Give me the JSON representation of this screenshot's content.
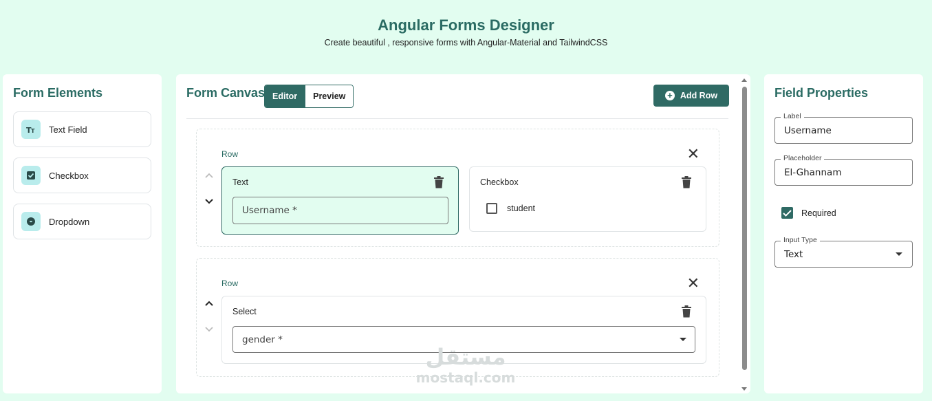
{
  "header": {
    "title": "Angular Forms Designer",
    "subtitle": "Create beautiful , responsive forms with Angular-Material and TailwindCSS"
  },
  "elements_panel": {
    "title": "Form Elements",
    "items": [
      {
        "label": "Text Field",
        "icon": "text-format-icon"
      },
      {
        "label": "Checkbox",
        "icon": "checkbox-icon"
      },
      {
        "label": "Dropdown",
        "icon": "dropdown-icon"
      }
    ]
  },
  "canvas": {
    "title": "Form Canvas",
    "tabs": [
      {
        "label": "Editor",
        "active": true
      },
      {
        "label": "Preview",
        "active": false
      }
    ],
    "add_row_label": "Add Row",
    "rows": [
      {
        "label": "Row",
        "fields": [
          {
            "type": "Text",
            "input_placeholder": "Username *",
            "selected": true
          },
          {
            "type": "Checkbox",
            "option_label": "student",
            "checked": false
          }
        ]
      },
      {
        "label": "Row",
        "fields": [
          {
            "type": "Select",
            "input_placeholder": "gender *"
          }
        ]
      }
    ]
  },
  "properties_panel": {
    "title": "Field Properties",
    "label_legend": "Label",
    "label_value": "Username",
    "placeholder_legend": "Placeholder",
    "placeholder_value": "El-Ghannam",
    "required_label": "Required",
    "required_checked": true,
    "input_type_legend": "Input Type",
    "input_type_value": "Text"
  },
  "watermark": {
    "arabic": "مستقل",
    "latin": "mostaql.com"
  },
  "colors": {
    "background": "#e2fdf0",
    "accent": "#2f6a64",
    "title": "#2a6b63",
    "icon_bg": "#b9ecec"
  }
}
